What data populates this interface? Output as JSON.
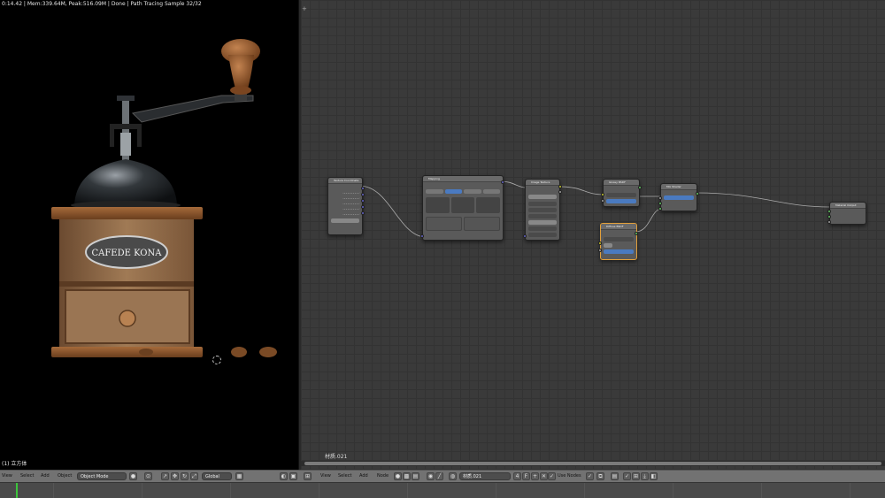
{
  "viewport": {
    "render_status": "0:14.42 | Mem:339.64M, Peak:516.09M | Done | Path Tracing Sample 32/32",
    "object_label": "(1) 立方体",
    "drawer_sign_text": "CAFEDE KONA"
  },
  "node_editor": {
    "material_name": "材质.021",
    "nodes": {
      "texture_coordinate": "Texture Coordinate",
      "mapping": "Mapping",
      "image_texture": "Image Texture",
      "glossy_bsdf": "Glossy BSDF",
      "diffuse_bsdf": "Diffuse BSDF",
      "mix_shader": "Mix Shader",
      "material_output": "Material Output"
    }
  },
  "header_left": {
    "view": "View",
    "select": "Select",
    "add": "Add",
    "object": "Object",
    "mode": "Object Mode",
    "orientation": "Global"
  },
  "header_right": {
    "view": "View",
    "select": "Select",
    "add": "Add",
    "node": "Node",
    "material_field": "材质.021",
    "f_label": "F",
    "use_nodes": "Use Nodes"
  },
  "colors": {
    "active_node_border": "#e3a03a",
    "timeline_marker": "#3cc43c",
    "socket_yellow": "#c7c729",
    "socket_purple": "#6363c7",
    "socket_green": "#63c763"
  }
}
